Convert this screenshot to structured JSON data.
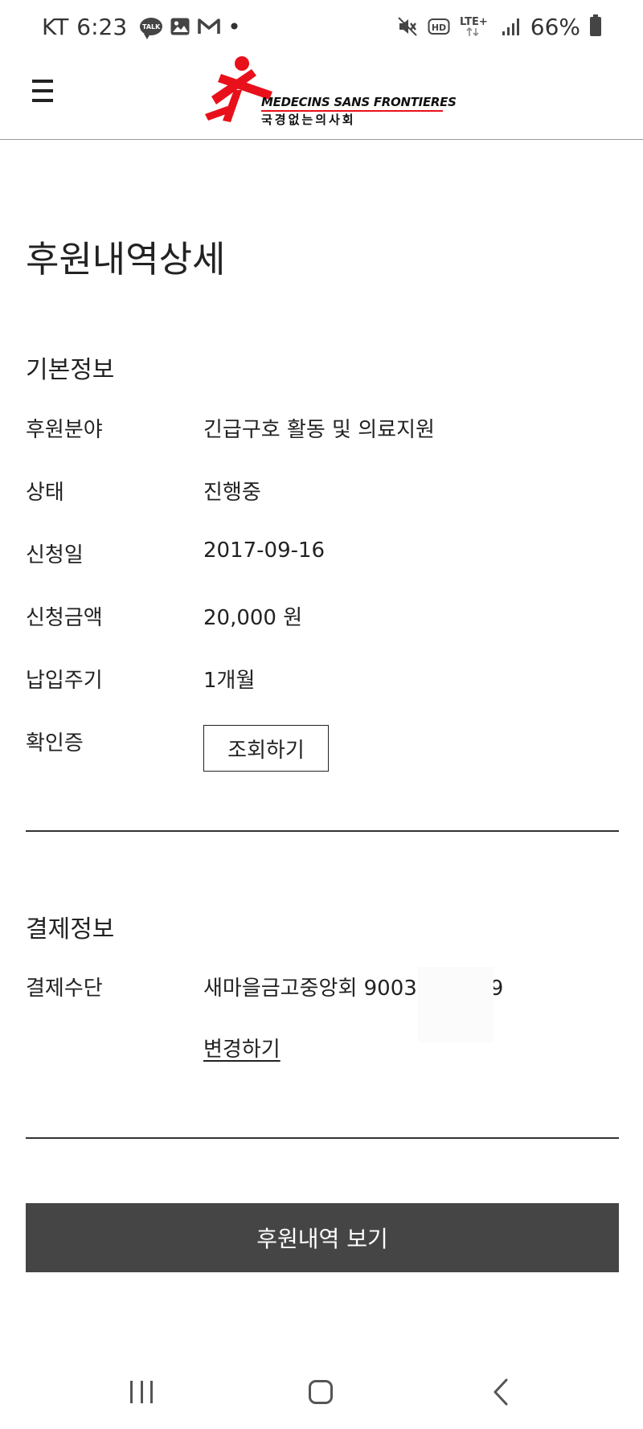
{
  "status_bar": {
    "carrier": "KT",
    "time": "6:23",
    "talk_label": "TALK",
    "dot": "•",
    "network": "LTE+",
    "battery": "66%"
  },
  "header": {
    "logo_en": "MEDECINS SANS FRONTIERES",
    "logo_ko": "국경없는의사회",
    "logo_color": "#e8101a"
  },
  "page": {
    "title": "후원내역상세"
  },
  "basic_info": {
    "title": "기본정보",
    "rows": [
      {
        "label": "후원분야",
        "value": "긴급구호 활동 및 의료지원"
      },
      {
        "label": "상태",
        "value": "진행중"
      },
      {
        "label": "신청일",
        "value": "2017-09-16"
      },
      {
        "label": "신청금액",
        "value": "20,000 원"
      },
      {
        "label": "납입주기",
        "value": "1개월"
      }
    ],
    "certificate_label": "확인증",
    "certificate_button": "조회하기"
  },
  "payment_info": {
    "title": "결제정보",
    "method_label": "결제수단",
    "method_value": "새마을금고중앙회 9003       639",
    "change_link": "변경하기"
  },
  "footer_button": "후원내역 보기"
}
